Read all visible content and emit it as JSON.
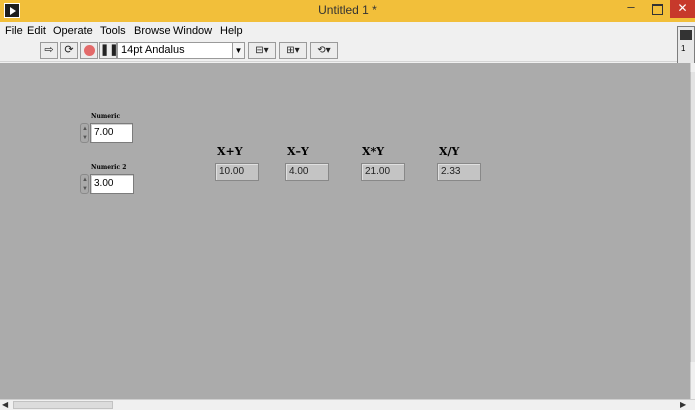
{
  "window": {
    "title": "Untitled 1 *",
    "minimize_glyph": "–",
    "close_glyph": "✕"
  },
  "menu": [
    {
      "label": "File"
    },
    {
      "label": "Edit"
    },
    {
      "label": "Operate"
    },
    {
      "label": "Tools"
    },
    {
      "label": "Browse"
    },
    {
      "label": "Window"
    },
    {
      "label": "Help"
    }
  ],
  "toolbar": {
    "run_icon": "run-arrow-icon",
    "run_continuous_icon": "run-continuous-icon",
    "abort_icon": "abort-icon",
    "pause_icon": "pause-icon",
    "font": "14pt Andalus",
    "align_icon": "align-objects-icon",
    "distribute_icon": "distribute-objects-icon",
    "reorder_icon": "reorder-icon"
  },
  "context_help": {
    "number": "1"
  },
  "controls": [
    {
      "label": "Numeric",
      "value": "7.00"
    },
    {
      "label": "Numeric 2",
      "value": "3.00"
    }
  ],
  "indicators": [
    {
      "label": "X+Y",
      "value": "10.00"
    },
    {
      "label": "X–Y",
      "value": "4.00"
    },
    {
      "label": "X*Y",
      "value": "21.00"
    },
    {
      "label": "X/Y",
      "value": "2.33"
    }
  ],
  "colors": {
    "titlebar": "#f2bf3a",
    "panel": "#ababab",
    "close_button": "#c7392b"
  }
}
